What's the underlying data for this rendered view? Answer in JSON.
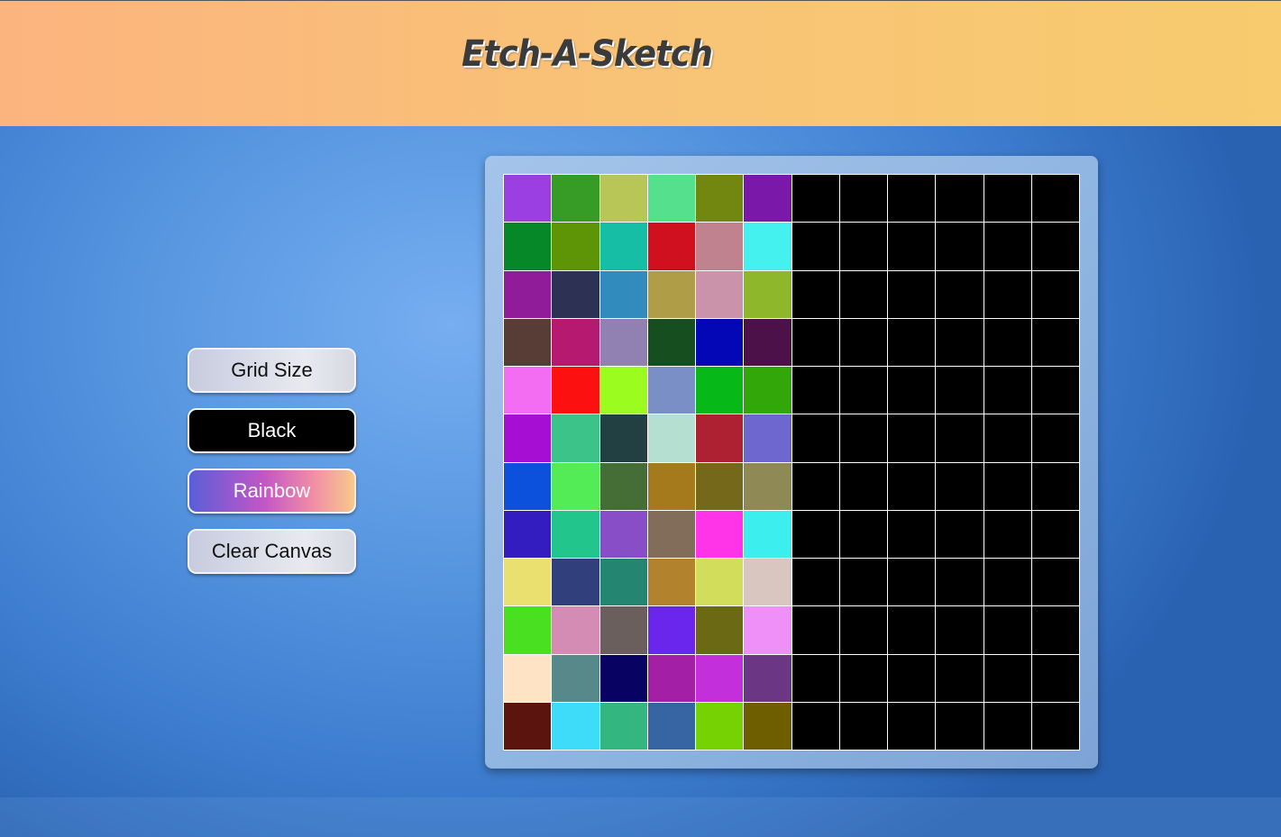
{
  "header": {
    "title": "Etch-A-Sketch"
  },
  "controls": {
    "grid_size_label": "Grid Size",
    "black_label": "Black",
    "rainbow_label": "Rainbow",
    "clear_label": "Clear Canvas"
  },
  "canvas": {
    "rows": 12,
    "cols": 12,
    "cells": [
      [
        "#9b3fe3",
        "#379c26",
        "#b8c657",
        "#55e08d",
        "#728710",
        "#7a18a9",
        "#000000",
        "#000000",
        "#000000",
        "#000000",
        "#000000",
        "#000000"
      ],
      [
        "#068828",
        "#5e9506",
        "#17bea6",
        "#d1101f",
        "#c0828e",
        "#45f1ee",
        "#000000",
        "#000000",
        "#000000",
        "#000000",
        "#000000",
        "#000000"
      ],
      [
        "#901c99",
        "#2d3153",
        "#318cbd",
        "#b09d48",
        "#cb93a9",
        "#8eb72b",
        "#000000",
        "#000000",
        "#000000",
        "#000000",
        "#000000",
        "#000000"
      ],
      [
        "#573d35",
        "#b51970",
        "#9180b2",
        "#164e20",
        "#0307b6",
        "#4c1148",
        "#000000",
        "#000000",
        "#000000",
        "#000000",
        "#000000",
        "#000000"
      ],
      [
        "#f26df2",
        "#fd1010",
        "#9bfc1f",
        "#7a8fc6",
        "#06b918",
        "#32a70a",
        "#000000",
        "#000000",
        "#000000",
        "#000000",
        "#000000",
        "#000000"
      ],
      [
        "#a60fd3",
        "#3bc38a",
        "#223f41",
        "#b4dfd1",
        "#ad2132",
        "#6e67cf",
        "#000000",
        "#000000",
        "#000000",
        "#000000",
        "#000000",
        "#000000"
      ],
      [
        "#0b51dc",
        "#53ec57",
        "#456e36",
        "#a57a1d",
        "#76681b",
        "#8f8955",
        "#000000",
        "#000000",
        "#000000",
        "#000000",
        "#000000",
        "#000000"
      ],
      [
        "#331cc0",
        "#22c68c",
        "#884ec8",
        "#826d5a",
        "#ff33e8",
        "#3deeee",
        "#000000",
        "#000000",
        "#000000",
        "#000000",
        "#000000",
        "#000000"
      ],
      [
        "#e9e06f",
        "#31407c",
        "#248670",
        "#b3822d",
        "#d2dd5b",
        "#dac6c0",
        "#000000",
        "#000000",
        "#000000",
        "#000000",
        "#000000",
        "#000000"
      ],
      [
        "#48e020",
        "#d58cb4",
        "#6a5f5d",
        "#6b26ee",
        "#6b6913",
        "#ee90f8",
        "#000000",
        "#000000",
        "#000000",
        "#000000",
        "#000000",
        "#000000"
      ],
      [
        "#ffe3c5",
        "#57898a",
        "#080262",
        "#a21fa6",
        "#c22fdb",
        "#6b3785",
        "#000000",
        "#000000",
        "#000000",
        "#000000",
        "#000000",
        "#000000"
      ],
      [
        "#5c140e",
        "#3edcf8",
        "#33b67f",
        "#3764a2",
        "#76d203",
        "#6e5e00",
        "#000000",
        "#000000",
        "#000000",
        "#000000",
        "#000000",
        "#000000"
      ]
    ]
  }
}
